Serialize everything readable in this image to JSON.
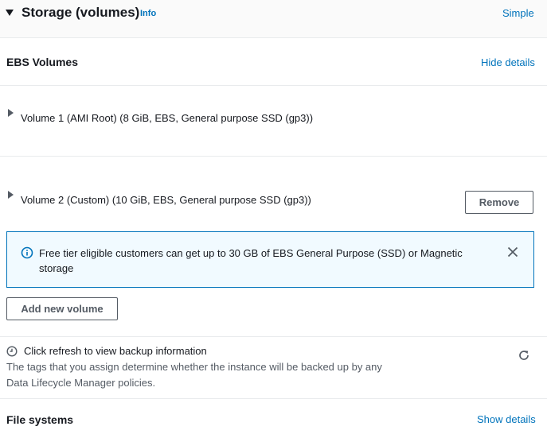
{
  "header": {
    "title": "Storage (volumes)",
    "info_label": "Info",
    "mode_link": "Simple"
  },
  "ebs": {
    "title": "EBS Volumes",
    "details_link": "Hide details",
    "volumes": [
      {
        "label": "Volume 1 (AMI Root) (8 GiB, EBS, General purpose SSD (gp3))"
      },
      {
        "label": "Volume 2 (Custom) (10 GiB, EBS, General purpose SSD (gp3))",
        "remove_label": "Remove"
      }
    ]
  },
  "alert": {
    "text": "Free tier eligible customers can get up to 30 GB of EBS General Purpose (SSD) or Magnetic storage"
  },
  "add_volume_label": "Add new volume",
  "backup": {
    "title": "Click refresh to view backup information",
    "description": "The tags that you assign determine whether the instance will be backed up by any Data Lifecycle Manager policies."
  },
  "file_systems": {
    "title": "File systems",
    "details_link": "Show details"
  },
  "colors": {
    "link": "#0073bb",
    "alert_bg": "#f1faff",
    "alert_border": "#0073bb",
    "text": "#16191f",
    "muted": "#545b64"
  }
}
